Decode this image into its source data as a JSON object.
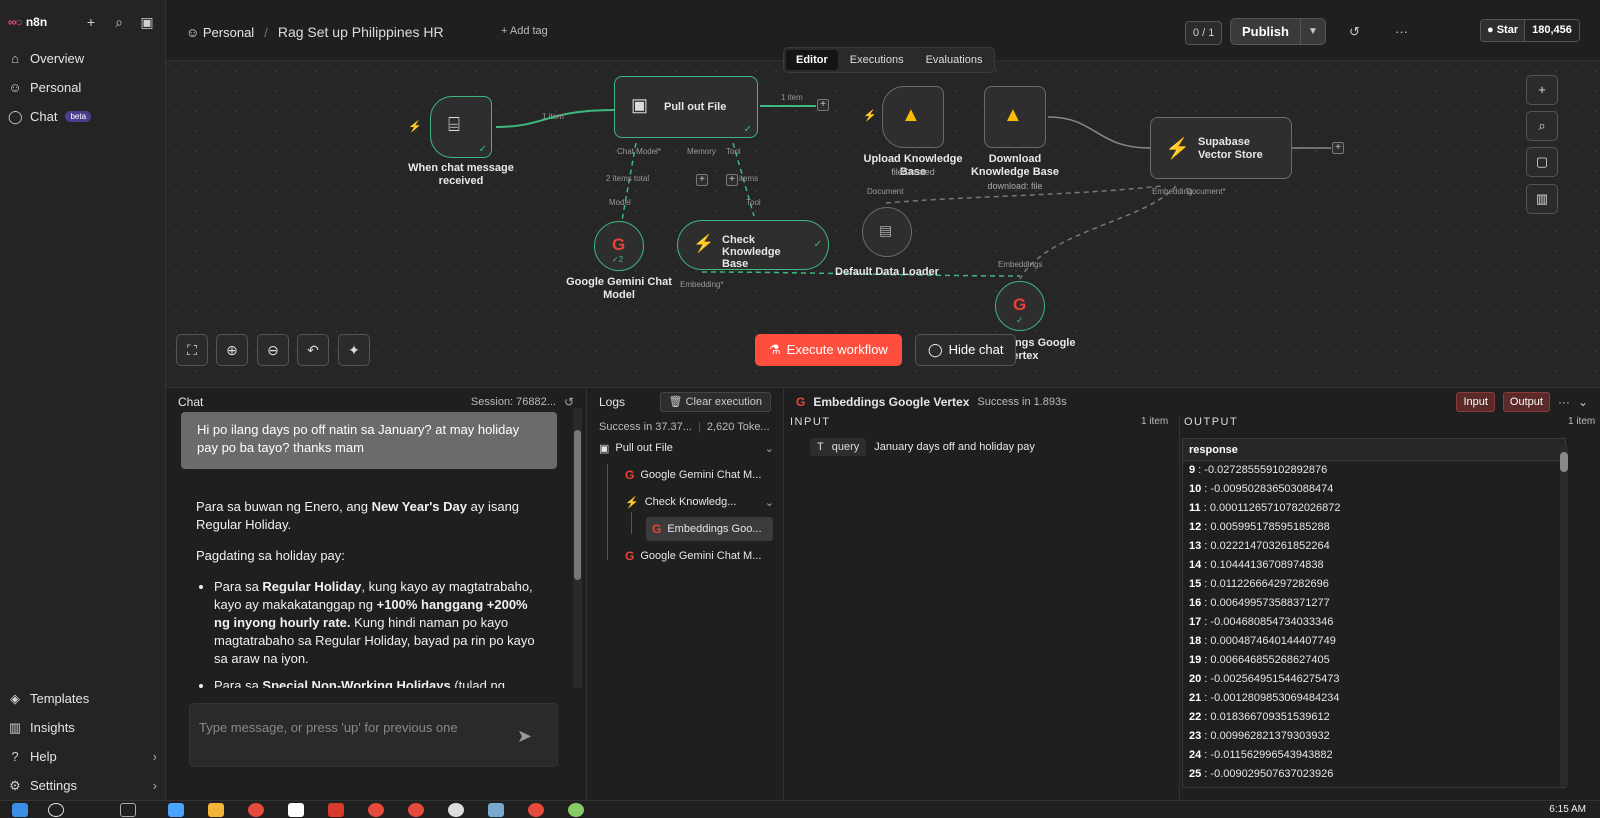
{
  "sidebar": {
    "brand": "n8n",
    "nav": [
      {
        "label": "Overview",
        "icon": "home-icon"
      },
      {
        "label": "Personal",
        "icon": "user-icon"
      },
      {
        "label": "Chat",
        "icon": "chat-icon",
        "badge": "beta"
      }
    ],
    "bottom": [
      {
        "label": "Templates",
        "icon": "templates-icon"
      },
      {
        "label": "Insights",
        "icon": "insights-icon"
      },
      {
        "label": "Help",
        "icon": "help-icon"
      },
      {
        "label": "Settings",
        "icon": "settings-icon"
      }
    ]
  },
  "header": {
    "project": "Personal",
    "workflow_title": "Rag Set up Philippines HR",
    "add_tag": "+ Add tag",
    "counter": "0 / 1",
    "publish": "Publish",
    "github_star": "Star",
    "github_count": "180,456"
  },
  "tabs": [
    "Editor",
    "Executions",
    "Evaluations"
  ],
  "canvas": {
    "nodes": {
      "chat_trigger": "When chat message received",
      "pull_out_file": "Pull out File",
      "upload_kb": "Upload Knowledge Base",
      "upload_kb_sub": "fileCreated",
      "download_kb": "Download Knowledge Base",
      "download_kb_sub": "download: file",
      "supabase": "Supabase Vector Store",
      "gemini": "Google Gemini Chat Model",
      "check_kb": "Check Knowledge Base",
      "loader": "Default Data Loader",
      "embeddings": "Embeddings Google Vertex"
    },
    "edge_labels": {
      "item1": "1 item",
      "item2": "1 item",
      "items_total": "2 items total",
      "items": "items"
    },
    "port_labels": {
      "chat_model": "Chat Model*",
      "memory": "Memory",
      "tool": "Tool",
      "model": "Model",
      "tool_in": "Tool",
      "embedding": "Embedding*",
      "document": "Document",
      "embeddings_port": "Embedding",
      "document_port": "Document*",
      "embeddings_in": "Embeddings"
    },
    "gemini_count": "2",
    "execute": "Execute workflow",
    "hide_chat": "Hide chat"
  },
  "chat": {
    "title": "Chat",
    "session": "Session: 76882...",
    "user_message": "Hi po ilang days po off natin sa January? at may holiday pay po ba tayo? thanks mam",
    "bot_p1_a": "Para sa buwan ng Enero, ang ",
    "bot_p1_b": "New Year's Day",
    "bot_p1_c": " ay isang Regular Holiday.",
    "bot_p2": "Pagdating sa holiday pay:",
    "bot_li1_a": "Para sa ",
    "bot_li1_b": "Regular Holiday",
    "bot_li1_c": ", kung kayo ay magtatrabaho, kayo ay makakatanggap ng ",
    "bot_li1_d": "+100% hanggang +200% ng inyong hourly rate.",
    "bot_li1_e": " Kung hindi naman po kayo magtatrabaho sa Regular Holiday, bayad pa rin po kayo sa araw na iyon.",
    "bot_li2_a": "Para sa ",
    "bot_li2_b": "Special Non-Working Holidays",
    "bot_li2_c": " (tulad ng",
    "input_placeholder": "Type message, or press 'up' for previous one"
  },
  "logs": {
    "title": "Logs",
    "clear": "Clear execution",
    "success": "Success in 37.37...",
    "tokens": "2,620 Toke...",
    "items": [
      {
        "label": "Pull out File"
      },
      {
        "label": "Google Gemini Chat M..."
      },
      {
        "label": "Check Knowledg..."
      },
      {
        "label": "Embeddings Goo..."
      },
      {
        "label": "Google Gemini Chat M..."
      }
    ]
  },
  "output_panel": {
    "node_name": "Embeddings Google Vertex",
    "status": "Success in 1.893s",
    "input_btn": "Input",
    "output_btn": "Output",
    "input_title": "INPUT",
    "input_count": "1 item",
    "output_title": "OUTPUT",
    "output_count": "1 item",
    "query_key": "query",
    "query_value": "January days off and holiday pay",
    "response_header": "response",
    "rows": [
      {
        "k": "9",
        "v": "-0.027285559102892876"
      },
      {
        "k": "10",
        "v": "-0.009502836503088474"
      },
      {
        "k": "11",
        "v": "0.00011265710782026872"
      },
      {
        "k": "12",
        "v": "0.005995178595185288"
      },
      {
        "k": "13",
        "v": "0.022214703261852264"
      },
      {
        "k": "14",
        "v": "0.10444136708974838"
      },
      {
        "k": "15",
        "v": "0.011226664297282696"
      },
      {
        "k": "16",
        "v": "0.006499573588371277"
      },
      {
        "k": "17",
        "v": "-0.004680854734033346"
      },
      {
        "k": "18",
        "v": "0.0004874640144407749"
      },
      {
        "k": "19",
        "v": "0.006646855268627405"
      },
      {
        "k": "20",
        "v": "-0.0025649515446275473"
      },
      {
        "k": "21",
        "v": "-0.0012809853069484234"
      },
      {
        "k": "22",
        "v": "0.018366709351539612"
      },
      {
        "k": "23",
        "v": "0.009962821379303932"
      },
      {
        "k": "24",
        "v": "-0.011562996543943882"
      },
      {
        "k": "25",
        "v": "-0.009029507637023926"
      }
    ]
  },
  "taskbar": {
    "clock": "6:15 AM"
  },
  "colors": {
    "accent": "#ff4e3d",
    "success": "#3fb87f",
    "brand": "#ea4b71"
  }
}
